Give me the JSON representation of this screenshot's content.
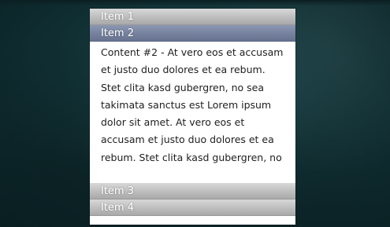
{
  "accordion": {
    "items": [
      {
        "label": "Item 1"
      },
      {
        "label": "Item 2"
      },
      {
        "label": "Item 3"
      },
      {
        "label": "Item 4"
      }
    ],
    "active_content": "Content #2 - At vero eos et accusam et justo duo dolores et ea rebum. Stet clita kasd gubergren, no sea takimata sanctus est Lorem ipsum dolor sit amet. At vero eos et accusam et justo duo dolores et ea rebum. Stet clita kasd gubergren, no"
  },
  "colors": {
    "active_header": "#75819d",
    "inactive_header": "#bdbdbd",
    "background": "#15393d"
  }
}
